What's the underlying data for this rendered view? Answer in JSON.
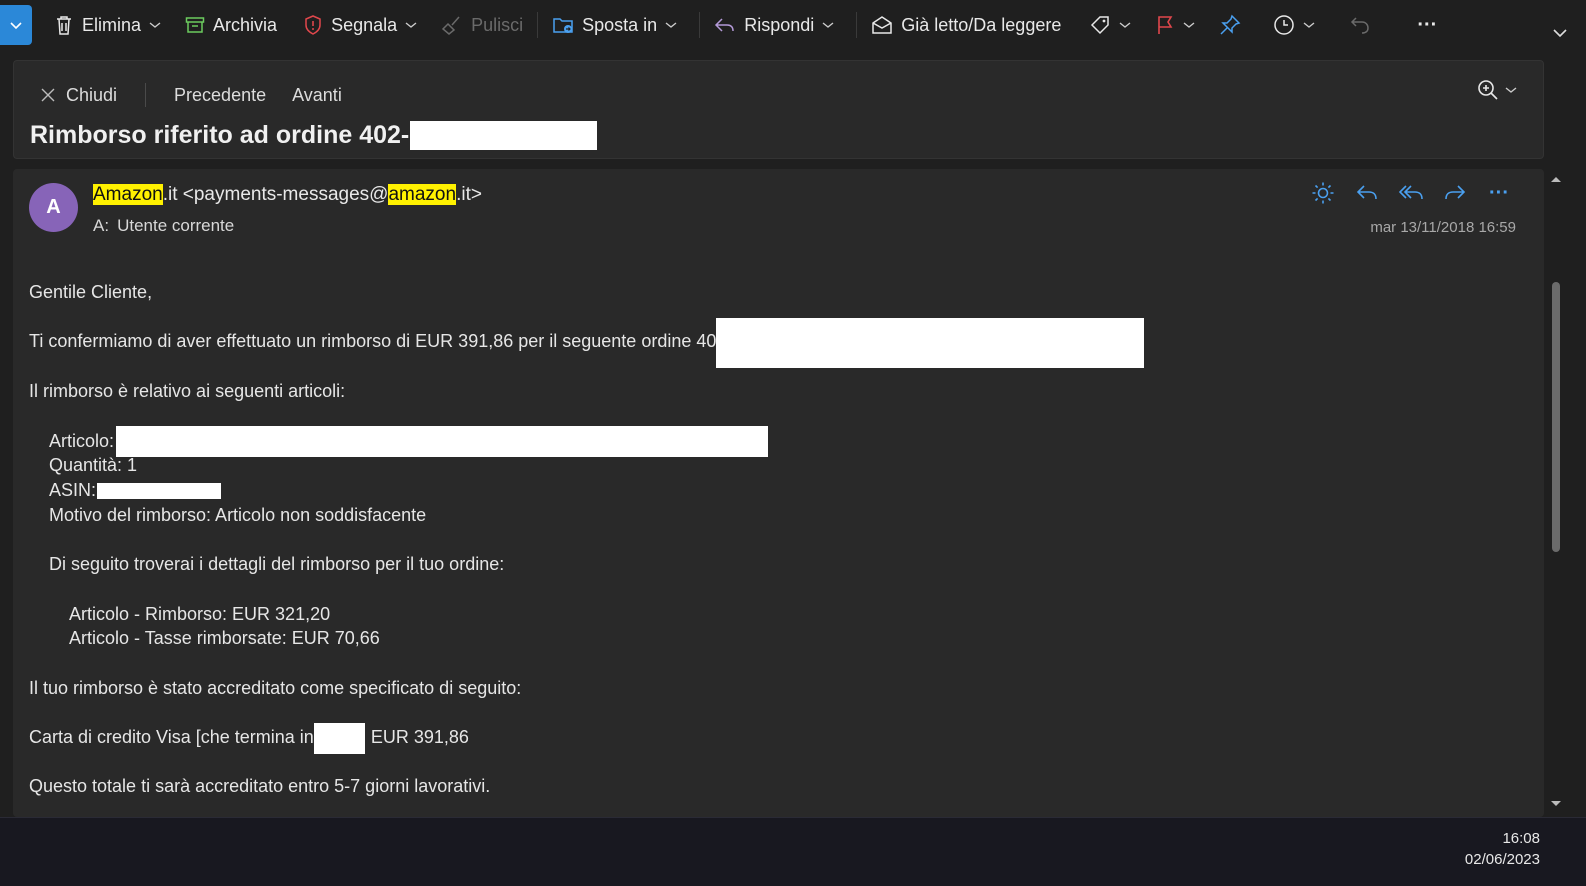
{
  "toolbar": {
    "delete": "Elimina",
    "archive": "Archivia",
    "report": "Segnala",
    "sweep": "Pulisci",
    "move_to": "Sposta in",
    "reply": "Rispondi",
    "read_unread": "Già letto/Da leggere",
    "more": "···"
  },
  "header": {
    "close": "Chiudi",
    "previous": "Precedente",
    "next": "Avanti",
    "subject": "Rimborso riferito ad ordine 402-"
  },
  "message": {
    "avatar_initial": "A",
    "from_hl1": "Amazon",
    "from_mid": ".it <payments-messages@",
    "from_hl2": "amazon",
    "from_end": ".it>",
    "to_label": "A:",
    "to_value": "Utente corrente",
    "date": "mar 13/11/2018 16:59",
    "more": "···"
  },
  "body": {
    "greeting": "Gentile Cliente,",
    "confirm": "Ti confermiamo di aver effettuato un rimborso di EUR 391,86 per il seguente ordine 40",
    "items_intro": "Il rimborso è relativo ai seguenti articoli:",
    "article_label": "Articolo:",
    "quantity": "Quantità: 1",
    "asin_label": "ASIN:",
    "reason": "Motivo del rimborso: Articolo non soddisfacente",
    "details_intro": "Di seguito troverai i dettagli del rimborso per il tuo ordine:",
    "refund_item": "Articolo - Rimborso: EUR 321,20",
    "refund_tax": "Articolo - Tasse rimborsate: EUR 70,66",
    "credited_intro": "Il tuo rimborso è stato accreditato come specificato di seguito:",
    "card_prefix": "Carta di credito Visa [che termina in",
    "card_amount": "EUR 391,86",
    "timing": "Questo totale ti sarà accreditato entro 5-7 giorni lavorativi."
  },
  "taskbar": {
    "time": "16:08",
    "date": "02/06/2023"
  },
  "colors": {
    "accent": "#2b88d8",
    "avatar": "#8764b8",
    "highlight": "#fff100",
    "flag": "#e0474c",
    "report": "#e0474c",
    "archive": "#6ccb5f"
  }
}
